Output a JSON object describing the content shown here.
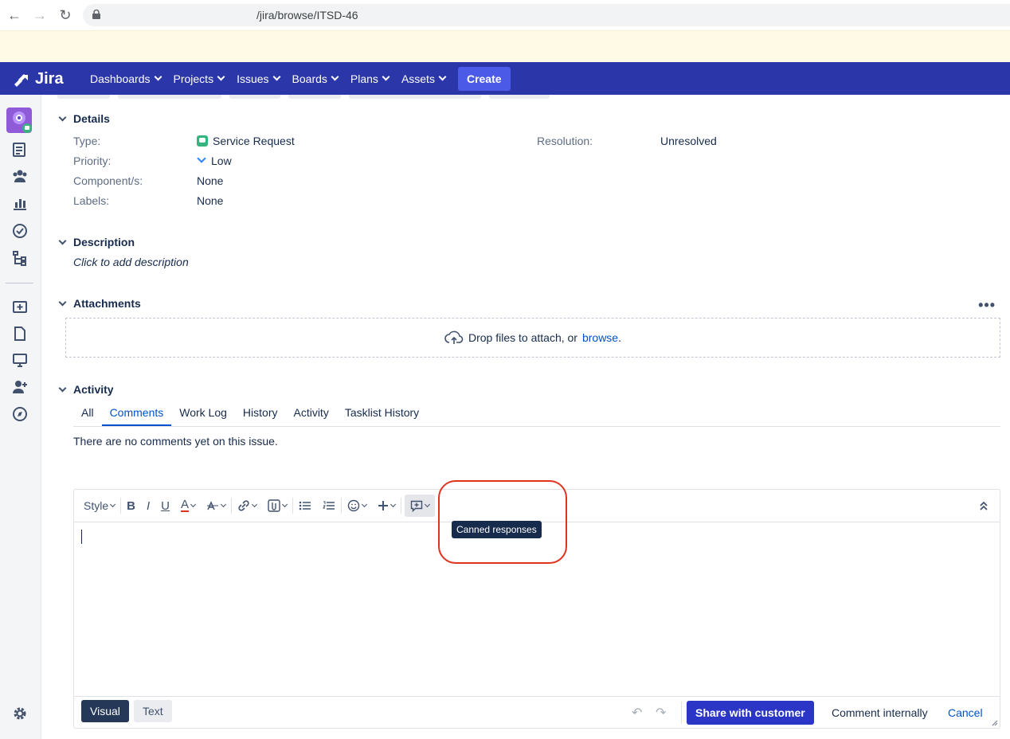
{
  "browser": {
    "url": "/jira/browse/ITSD-46"
  },
  "topnav": {
    "logo": "Jira",
    "menu": [
      "Dashboards",
      "Projects",
      "Issues",
      "Boards",
      "Plans",
      "Assets"
    ],
    "create": "Create"
  },
  "details": {
    "heading": "Details",
    "type_label": "Type:",
    "type_value": "Service Request",
    "priority_label": "Priority:",
    "priority_value": "Low",
    "components_label": "Component/s:",
    "components_value": "None",
    "labels_label": "Labels:",
    "labels_value": "None",
    "resolution_label": "Resolution:",
    "resolution_value": "Unresolved"
  },
  "description": {
    "heading": "Description",
    "placeholder": "Click to add description"
  },
  "attachments": {
    "heading": "Attachments",
    "more": "•••",
    "drop_text": "Drop files to attach, or",
    "browse": "browse",
    "period": "."
  },
  "activity": {
    "heading": "Activity",
    "tabs": [
      "All",
      "Comments",
      "Work Log",
      "History",
      "Activity",
      "Tasklist History"
    ],
    "active_tab": "Comments",
    "empty": "There are no comments yet on this issue."
  },
  "editor": {
    "style": "Style",
    "bold": "B",
    "italic": "I",
    "underline": "U",
    "text_color": "A",
    "tooltip": "Canned responses",
    "mode_visual": "Visual",
    "mode_text": "Text",
    "share": "Share with customer",
    "internal": "Comment internally",
    "cancel": "Cancel"
  },
  "colors": {
    "nav_bg": "#2b36a8",
    "primary": "#2b36c7",
    "highlight": "#e0321c"
  }
}
